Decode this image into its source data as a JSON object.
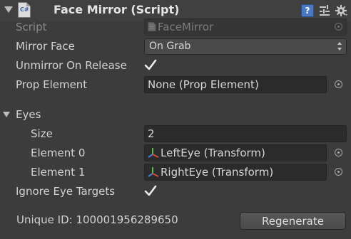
{
  "header": {
    "title": "Face Mirror (Script)",
    "script_icon_text": "C#",
    "icons": [
      "help-icon",
      "presets-icon",
      "gear-icon"
    ]
  },
  "script": {
    "label": "Script",
    "value": "FaceMirror"
  },
  "mirror_face": {
    "label": "Mirror Face",
    "selected": "On Grab"
  },
  "unmirror_on_release": {
    "label": "Unmirror On Release",
    "checked": true
  },
  "prop_element": {
    "label": "Prop Element",
    "value": "None (Prop Element)"
  },
  "eyes": {
    "label": "Eyes",
    "expanded": true,
    "size_label": "Size",
    "size_value": "2",
    "elements": [
      {
        "label": "Element 0",
        "value": "LeftEye (Transform)"
      },
      {
        "label": "Element 1",
        "value": "RightEye (Transform)"
      }
    ]
  },
  "ignore_eye_targets": {
    "label": "Ignore Eye Targets",
    "checked": true
  },
  "footer": {
    "unique_id": "Unique ID: 100001956289650",
    "regenerate_label": "Regenerate"
  },
  "colors": {
    "background": "#3c3c3c",
    "field": "#2b2b2b",
    "text": "#d2d2d2",
    "accent": "#4a78c2"
  }
}
